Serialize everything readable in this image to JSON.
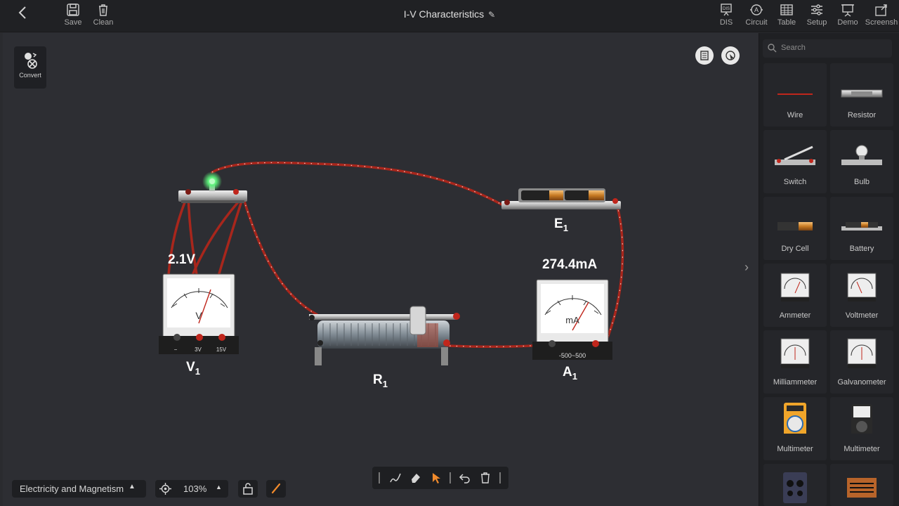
{
  "toolbar": {
    "save_label": "Save",
    "clean_label": "Clean",
    "title": "I-V Characteristics",
    "dis_label": "DIS",
    "circuit_label": "Circuit",
    "table_label": "Table",
    "setup_label": "Setup",
    "demo_label": "Demo",
    "screenshot_label": "Screensh"
  },
  "canvas": {
    "convert_label": "Convert",
    "voltmeter_reading": "2.1V",
    "ammeter_reading": "274.4mA",
    "voltmeter_name": "V",
    "voltmeter_sub": "1",
    "ammeter_name": "A",
    "ammeter_sub": "1",
    "battery_name": "E",
    "battery_sub": "1",
    "rheostat_name": "R",
    "rheostat_sub": "1",
    "voltmeter_terminals": [
      "−",
      "3V",
      "15V"
    ],
    "voltmeter_unit": "V",
    "ammeter_unit": "mA",
    "ammeter_range": "-500~500"
  },
  "sidebar": {
    "search_placeholder": "Search",
    "items": [
      {
        "label": "Wire"
      },
      {
        "label": "Resistor"
      },
      {
        "label": "Switch"
      },
      {
        "label": "Bulb"
      },
      {
        "label": "Dry Cell"
      },
      {
        "label": "Battery"
      },
      {
        "label": "Ammeter"
      },
      {
        "label": "Voltmeter"
      },
      {
        "label": "Milliammeter"
      },
      {
        "label": "Galvanometer"
      },
      {
        "label": "Multimeter"
      },
      {
        "label": "Multimeter"
      }
    ]
  },
  "bottom": {
    "category": "Electricity and Magnetism",
    "zoom": "103%"
  },
  "colors": {
    "wire": "#b5241c",
    "accent": "#f08a2c",
    "led": "#5cf07a"
  }
}
